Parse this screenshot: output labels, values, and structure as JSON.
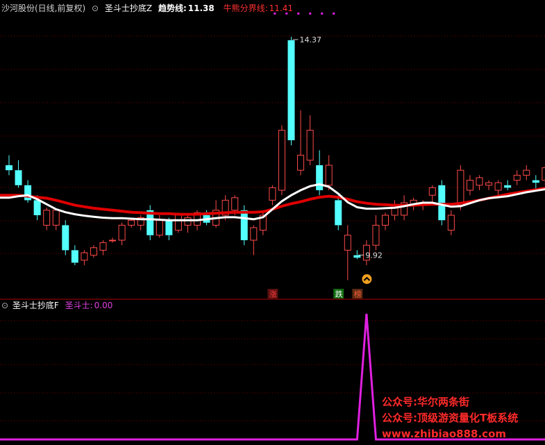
{
  "main_header": {
    "stock_title": "沙河股份(日线,前复权)",
    "indicator_name": "圣斗士抄底Z",
    "trend_label": "趋势线:",
    "trend_value": "11.38",
    "bull_bear_label": "牛熊分界线:",
    "bull_bear_value": "11.41"
  },
  "sub_header": {
    "indicator_name": "圣斗士抄底F",
    "value_label": "圣斗士:",
    "value": "0.00"
  },
  "colors": {
    "up_candle": "#ff4a4a",
    "down_candle": "#54ffff",
    "trend_line": "#ffffff",
    "bull_bear_line": "#e00000",
    "signal_line": "#e020e0",
    "grid": "#7a0000",
    "stock_title": "#d0d0d0",
    "indicator_title": "#ffffff",
    "trend_label_color": "#ffffff",
    "bull_bear_label_color": "#ff3030",
    "signal_label_color": "#e040e0",
    "watermark": "#ff2a2a"
  },
  "chart_data": [
    {
      "type": "candlestick",
      "title": "沙河股份(日线,前复权)",
      "ylim": [
        9.3,
        14.8
      ],
      "candles": [
        {
          "o": 11.8,
          "h": 12.0,
          "l": 11.6,
          "c": 11.7,
          "dir": "down"
        },
        {
          "o": 11.7,
          "h": 11.9,
          "l": 11.35,
          "c": 11.4,
          "dir": "down"
        },
        {
          "o": 11.4,
          "h": 11.5,
          "l": 11.05,
          "c": 11.1,
          "dir": "down"
        },
        {
          "o": 11.1,
          "h": 11.2,
          "l": 10.7,
          "c": 10.8,
          "dir": "down"
        },
        {
          "o": 10.6,
          "h": 10.95,
          "l": 10.5,
          "c": 10.9,
          "dir": "up"
        },
        {
          "o": 10.6,
          "h": 10.9,
          "l": 10.5,
          "c": 10.9,
          "dir": "up"
        },
        {
          "o": 10.6,
          "h": 10.7,
          "l": 10.0,
          "c": 10.1,
          "dir": "down"
        },
        {
          "o": 10.1,
          "h": 10.2,
          "l": 9.8,
          "c": 9.85,
          "dir": "down"
        },
        {
          "o": 9.9,
          "h": 10.1,
          "l": 9.8,
          "c": 10.05,
          "dir": "up"
        },
        {
          "o": 10.0,
          "h": 10.2,
          "l": 9.95,
          "c": 10.15,
          "dir": "up"
        },
        {
          "o": 10.1,
          "h": 10.3,
          "l": 10.0,
          "c": 10.25,
          "dir": "up"
        },
        {
          "o": 10.3,
          "h": 10.35,
          "l": 10.25,
          "c": 10.3,
          "dir": "up"
        },
        {
          "o": 10.3,
          "h": 10.65,
          "l": 10.2,
          "c": 10.6,
          "dir": "up"
        },
        {
          "o": 10.6,
          "h": 10.75,
          "l": 10.55,
          "c": 10.7,
          "dir": "up"
        },
        {
          "o": 10.6,
          "h": 10.8,
          "l": 10.5,
          "c": 10.75,
          "dir": "up"
        },
        {
          "o": 10.9,
          "h": 11.0,
          "l": 10.3,
          "c": 10.4,
          "dir": "down"
        },
        {
          "o": 10.4,
          "h": 10.8,
          "l": 10.35,
          "c": 10.7,
          "dir": "up"
        },
        {
          "o": 10.7,
          "h": 10.75,
          "l": 10.3,
          "c": 10.4,
          "dir": "down"
        },
        {
          "o": 10.5,
          "h": 10.85,
          "l": 10.45,
          "c": 10.8,
          "dir": "up"
        },
        {
          "o": 10.6,
          "h": 10.8,
          "l": 10.45,
          "c": 10.75,
          "dir": "up"
        },
        {
          "o": 10.6,
          "h": 10.9,
          "l": 10.5,
          "c": 10.85,
          "dir": "up"
        },
        {
          "o": 10.8,
          "h": 10.9,
          "l": 10.6,
          "c": 10.65,
          "dir": "down"
        },
        {
          "o": 10.6,
          "h": 11.1,
          "l": 10.55,
          "c": 10.9,
          "dir": "up"
        },
        {
          "o": 10.8,
          "h": 11.2,
          "l": 10.7,
          "c": 11.1,
          "dir": "up"
        },
        {
          "o": 10.9,
          "h": 11.2,
          "l": 10.8,
          "c": 11.15,
          "dir": "up"
        },
        {
          "o": 10.9,
          "h": 11.0,
          "l": 10.2,
          "c": 10.3,
          "dir": "down"
        },
        {
          "o": 10.3,
          "h": 10.6,
          "l": 10.0,
          "c": 10.55,
          "dir": "up"
        },
        {
          "o": 10.5,
          "h": 10.9,
          "l": 10.4,
          "c": 10.8,
          "dir": "up"
        },
        {
          "o": 11.1,
          "h": 11.4,
          "l": 11.0,
          "c": 11.35,
          "dir": "up"
        },
        {
          "o": 11.3,
          "h": 12.6,
          "l": 11.2,
          "c": 12.5,
          "dir": "up"
        },
        {
          "o": 14.3,
          "h": 14.37,
          "l": 12.2,
          "c": 12.3,
          "dir": "down"
        },
        {
          "o": 11.7,
          "h": 12.9,
          "l": 11.6,
          "c": 12.0,
          "dir": "up"
        },
        {
          "o": 11.9,
          "h": 12.8,
          "l": 11.8,
          "c": 12.5,
          "dir": "up"
        },
        {
          "o": 11.8,
          "h": 12.1,
          "l": 11.2,
          "c": 11.3,
          "dir": "down"
        },
        {
          "o": 11.4,
          "h": 12.0,
          "l": 11.3,
          "c": 11.8,
          "dir": "up"
        },
        {
          "o": 11.1,
          "h": 11.2,
          "l": 10.5,
          "c": 10.6,
          "dir": "down"
        },
        {
          "o": 10.4,
          "h": 10.6,
          "l": 9.5,
          "c": 10.1,
          "dir": "up"
        },
        {
          "o": 10.0,
          "h": 10.1,
          "l": 9.92,
          "c": 9.95,
          "dir": "down"
        },
        {
          "o": 9.9,
          "h": 10.3,
          "l": 9.8,
          "c": 10.2,
          "dir": "up"
        },
        {
          "o": 10.2,
          "h": 10.8,
          "l": 10.1,
          "c": 10.6,
          "dir": "up"
        },
        {
          "o": 10.6,
          "h": 10.85,
          "l": 10.5,
          "c": 10.8,
          "dir": "up"
        },
        {
          "o": 10.8,
          "h": 11.1,
          "l": 10.7,
          "c": 11.0,
          "dir": "up"
        },
        {
          "o": 10.8,
          "h": 11.2,
          "l": 10.7,
          "c": 11.05,
          "dir": "up"
        },
        {
          "o": 11.0,
          "h": 11.15,
          "l": 10.9,
          "c": 11.1,
          "dir": "up"
        },
        {
          "o": 11.0,
          "h": 11.1,
          "l": 10.9,
          "c": 11.05,
          "dir": "up"
        },
        {
          "o": 11.2,
          "h": 11.4,
          "l": 11.0,
          "c": 11.35,
          "dir": "up"
        },
        {
          "o": 11.4,
          "h": 11.5,
          "l": 10.6,
          "c": 10.7,
          "dir": "down"
        },
        {
          "o": 10.5,
          "h": 10.9,
          "l": 10.4,
          "c": 10.8,
          "dir": "up"
        },
        {
          "o": 11.0,
          "h": 11.8,
          "l": 10.9,
          "c": 11.7,
          "dir": "up"
        },
        {
          "o": 11.3,
          "h": 11.6,
          "l": 11.2,
          "c": 11.5,
          "dir": "up"
        },
        {
          "o": 11.4,
          "h": 11.6,
          "l": 11.3,
          "c": 11.55,
          "dir": "up"
        },
        {
          "o": 11.4,
          "h": 11.5,
          "l": 11.3,
          "c": 11.45,
          "dir": "up"
        },
        {
          "o": 11.3,
          "h": 11.5,
          "l": 11.2,
          "c": 11.45,
          "dir": "up"
        },
        {
          "o": 11.4,
          "h": 11.5,
          "l": 11.3,
          "c": 11.35,
          "dir": "down"
        },
        {
          "o": 11.5,
          "h": 11.7,
          "l": 11.4,
          "c": 11.6,
          "dir": "up"
        },
        {
          "o": 11.6,
          "h": 11.8,
          "l": 11.5,
          "c": 11.7,
          "dir": "up"
        },
        {
          "o": 11.5,
          "h": 11.6,
          "l": 11.3,
          "c": 11.45,
          "dir": "down"
        },
        {
          "o": 11.5,
          "h": 11.8,
          "l": 11.4,
          "c": 11.75,
          "dir": "up"
        }
      ],
      "trend_line": [
        11.15,
        11.18,
        11.2,
        11.12,
        11.02,
        10.92,
        10.86,
        10.82,
        10.79,
        10.77,
        10.75,
        10.74,
        10.74,
        10.73,
        10.72,
        10.72,
        10.71,
        10.7,
        10.7,
        10.7,
        10.7,
        10.72,
        10.74,
        10.76,
        10.76,
        10.74,
        10.72,
        10.76,
        10.92,
        11.08,
        11.2,
        11.3,
        11.38,
        11.42,
        11.37,
        11.23,
        11.06,
        10.96,
        10.93,
        10.93,
        10.94,
        10.95,
        10.98,
        11.02,
        11.05,
        11.05,
        11.01,
        10.97,
        10.98,
        11.04,
        11.1,
        11.14,
        11.16,
        11.18,
        11.22,
        11.26,
        11.29,
        11.32
      ],
      "bull_bear_line": [
        11.2,
        11.2,
        11.18,
        11.16,
        11.14,
        11.1,
        11.05,
        11.0,
        10.97,
        10.94,
        10.92,
        10.9,
        10.88,
        10.86,
        10.85,
        10.84,
        10.83,
        10.83,
        10.82,
        10.82,
        10.82,
        10.83,
        10.84,
        10.85,
        10.86,
        10.86,
        10.86,
        10.87,
        10.92,
        10.98,
        11.03,
        11.07,
        11.12,
        11.16,
        11.18,
        11.16,
        11.12,
        11.07,
        11.04,
        11.02,
        11.01,
        11.0,
        11.0,
        11.0,
        11.01,
        11.02,
        11.02,
        11.02,
        11.04,
        11.07,
        11.1,
        11.14,
        11.18,
        11.22,
        11.25,
        11.28,
        11.31,
        11.34
      ],
      "annotations": [
        {
          "label": "14.37",
          "type": "high",
          "candle_index": 30
        },
        {
          "label": "9.92",
          "type": "low",
          "candle_index": 37
        }
      ],
      "top_markers_from_candle": 35,
      "signal_icon_at_candle": 38,
      "tags": [
        {
          "text": "涨",
          "candle_index": 28,
          "bg": "#5a1010",
          "fg": "#ff4040"
        },
        {
          "text": "跌",
          "candle_index": 35,
          "bg": "#106a10",
          "fg": "#ffffff"
        },
        {
          "text": "榜",
          "candle_index": 37,
          "bg": "#5a2a10",
          "fg": "#ff6040"
        }
      ]
    },
    {
      "type": "line",
      "title": "圣斗士抄底F",
      "series": [
        {
          "name": "圣斗士",
          "values": [
            0,
            0,
            0,
            0,
            0,
            0,
            0,
            0,
            0,
            0,
            0,
            0,
            0,
            0,
            0,
            0,
            0,
            0,
            0,
            0,
            0,
            0,
            0,
            0,
            0,
            0,
            0,
            0,
            0,
            0,
            0,
            0,
            0,
            0,
            0,
            0,
            0,
            0,
            1,
            0,
            0,
            0,
            0,
            0,
            0,
            0,
            0,
            0,
            0,
            0,
            0,
            0,
            0,
            0,
            0,
            0,
            0,
            0
          ]
        }
      ],
      "ylim": [
        0,
        1
      ]
    }
  ],
  "watermarks": [
    "公众号:华尔两条街",
    "公众号:顶级游资量化T板系统",
    "www.zhibiao888.com"
  ]
}
